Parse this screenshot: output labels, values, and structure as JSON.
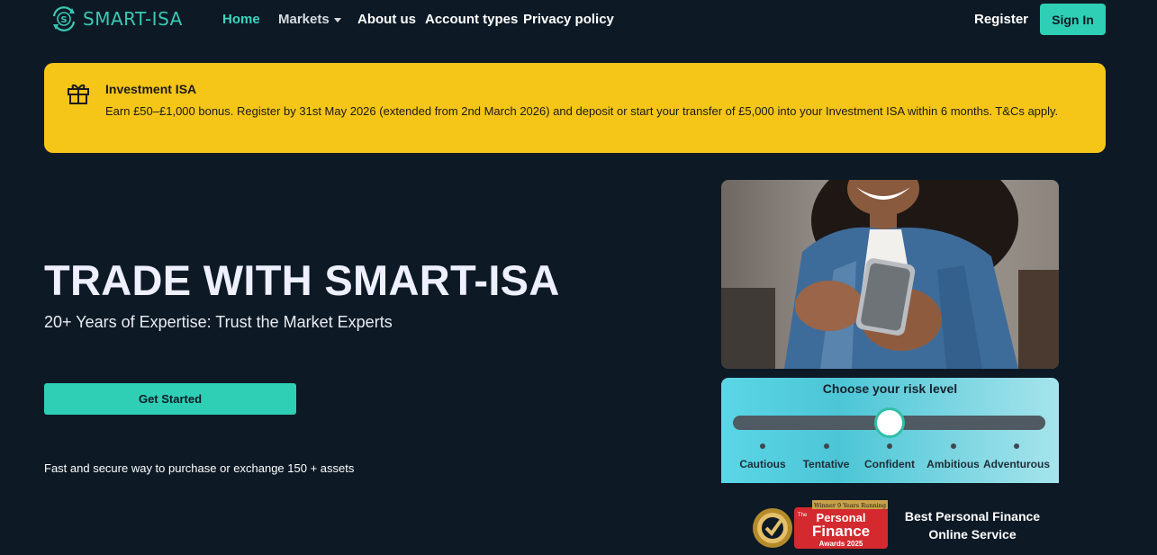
{
  "nav": {
    "logo_text": "SMART-ISA",
    "links": [
      {
        "label": "Home"
      },
      {
        "label": "Markets"
      },
      {
        "label": "About us"
      },
      {
        "label": "Account types"
      },
      {
        "label": "Privacy policy"
      }
    ],
    "register_label": "Register",
    "signin_label": "Sign In"
  },
  "banner": {
    "icon": "gift-icon",
    "title": "Investment ISA",
    "text": "Earn £50–£1,000 bonus. Register by 31st May 2026 (extended from 2nd March 2026) and deposit or start your transfer of £5,000 into your Investment ISA within 6 months. T&Cs apply."
  },
  "hero": {
    "title": "TRADE WITH SMART-ISA",
    "subtitle": "20+ Years of Expertise: Trust the Market Experts",
    "cta_label": "Get Started",
    "footnote": "Fast and secure way to purchase or exchange 150 + assets"
  },
  "risk": {
    "title": "Choose your risk level",
    "levels": [
      "Cautious",
      "Tentative",
      "Confident",
      "Ambitious",
      "Adventurous"
    ],
    "selected_index": 2
  },
  "award": {
    "badge_top": "Winner 9 Years Running",
    "badge_the": "The",
    "badge_line1": "Personal",
    "badge_line2": "Finance",
    "badge_line3": "Awards 2025",
    "line1": "Best Personal Finance",
    "line2": "Online Service"
  },
  "colors": {
    "background": "#0d1a26",
    "accent": "#2ecfb4",
    "banner": "#f5c518"
  }
}
